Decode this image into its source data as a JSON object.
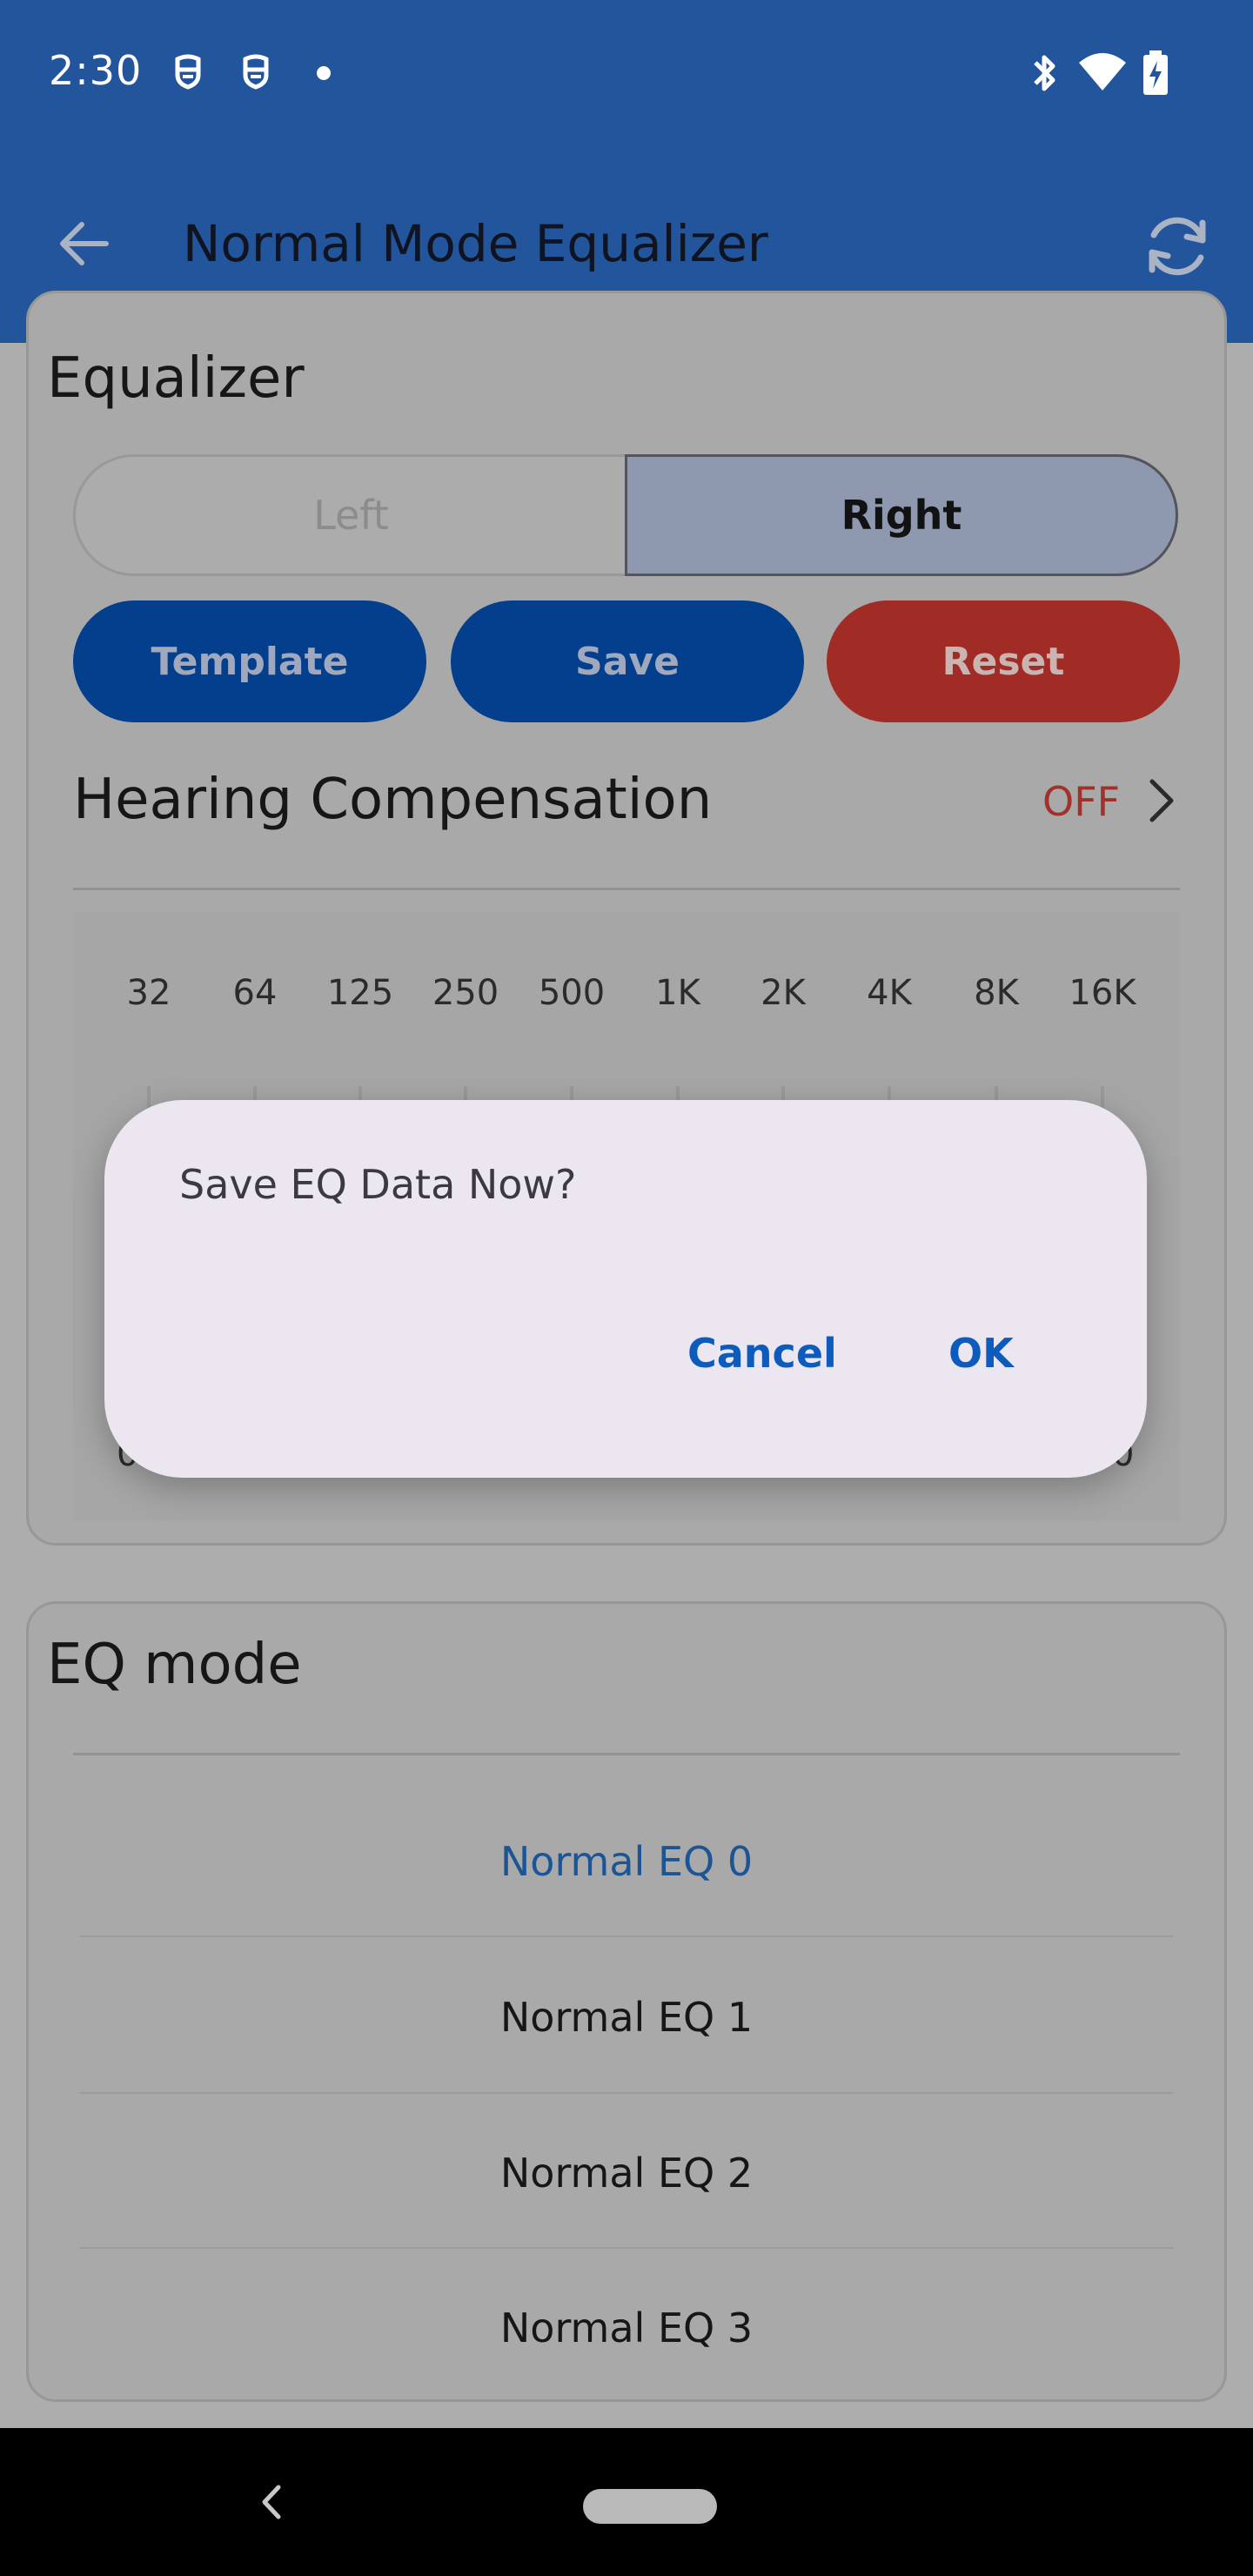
{
  "status_bar": {
    "time": "2:30"
  },
  "app_bar": {
    "title": "Normal Mode Equalizer"
  },
  "equalizer": {
    "title": "Equalizer",
    "channels": {
      "left": "Left",
      "right": "Right",
      "selected": "Right"
    },
    "buttons": {
      "template": "Template",
      "save": "Save",
      "reset": "Reset"
    },
    "hearing_compensation": {
      "label": "Hearing Compensation",
      "status": "OFF"
    },
    "frequencies": [
      "32",
      "64",
      "125",
      "250",
      "500",
      "1K",
      "2K",
      "4K",
      "8K",
      "16K"
    ],
    "edge_labels": {
      "left": "0.",
      "right": "0"
    }
  },
  "eq_mode": {
    "title": "EQ mode",
    "items": [
      "Normal EQ 0",
      "Normal EQ 1",
      "Normal EQ 2",
      "Normal EQ 3"
    ],
    "selected": "Normal EQ 0"
  },
  "dialog": {
    "message": "Save EQ Data Now?",
    "cancel": "Cancel",
    "ok": "OK"
  },
  "colors": {
    "app_bar": "#22559c",
    "primary_button": "#033f8c",
    "reset_button": "#a12b25",
    "selected_text": "#1c5596",
    "dialog_action": "#0c5bbd"
  }
}
